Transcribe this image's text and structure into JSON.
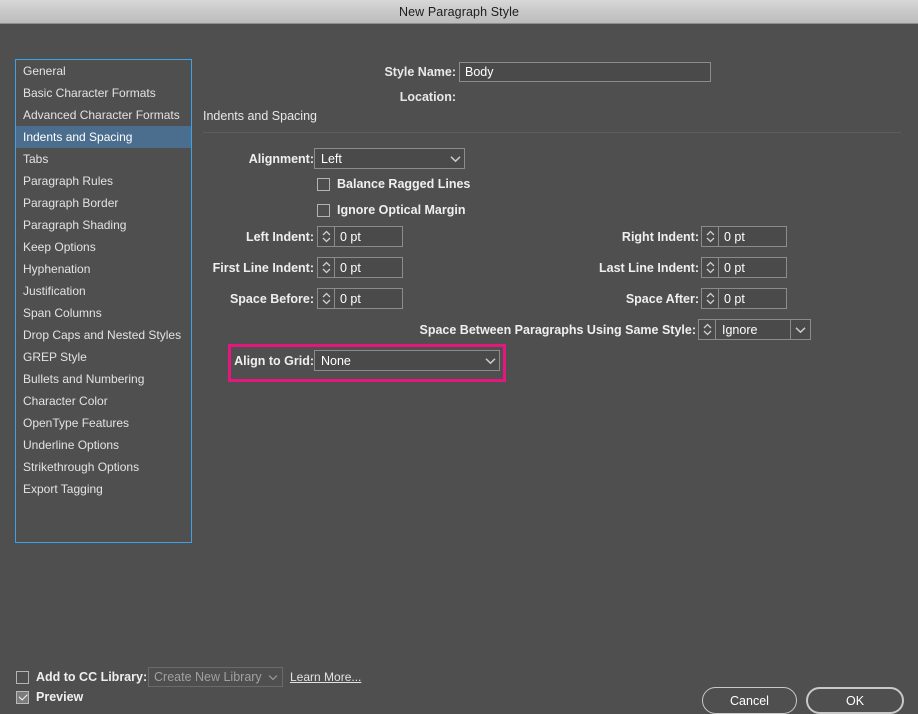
{
  "window": {
    "title": "New Paragraph Style"
  },
  "sidebar": {
    "items": [
      {
        "label": "General",
        "selected": false
      },
      {
        "label": "Basic Character Formats",
        "selected": false
      },
      {
        "label": "Advanced Character Formats",
        "selected": false
      },
      {
        "label": "Indents and Spacing",
        "selected": true
      },
      {
        "label": "Tabs",
        "selected": false
      },
      {
        "label": "Paragraph Rules",
        "selected": false
      },
      {
        "label": "Paragraph Border",
        "selected": false
      },
      {
        "label": "Paragraph Shading",
        "selected": false
      },
      {
        "label": "Keep Options",
        "selected": false
      },
      {
        "label": "Hyphenation",
        "selected": false
      },
      {
        "label": "Justification",
        "selected": false
      },
      {
        "label": "Span Columns",
        "selected": false
      },
      {
        "label": "Drop Caps and Nested Styles",
        "selected": false
      },
      {
        "label": "GREP Style",
        "selected": false
      },
      {
        "label": "Bullets and Numbering",
        "selected": false
      },
      {
        "label": "Character Color",
        "selected": false
      },
      {
        "label": "OpenType Features",
        "selected": false
      },
      {
        "label": "Underline Options",
        "selected": false
      },
      {
        "label": "Strikethrough Options",
        "selected": false
      },
      {
        "label": "Export Tagging",
        "selected": false
      }
    ]
  },
  "header": {
    "style_name_label": "Style Name:",
    "style_name_value": "Body",
    "location_label": "Location:",
    "location_value": ""
  },
  "panel": {
    "title": "Indents and Spacing",
    "alignment": {
      "label": "Alignment:",
      "value": "Left"
    },
    "balance_ragged_lines": {
      "label": "Balance Ragged Lines",
      "checked": false
    },
    "ignore_optical_margin": {
      "label": "Ignore Optical Margin",
      "checked": false
    },
    "left_indent": {
      "label": "Left Indent:",
      "value": "0 pt"
    },
    "first_line_indent": {
      "label": "First Line Indent:",
      "value": "0 pt"
    },
    "space_before": {
      "label": "Space Before:",
      "value": "0 pt"
    },
    "right_indent": {
      "label": "Right Indent:",
      "value": "0 pt"
    },
    "last_line_indent": {
      "label": "Last Line Indent:",
      "value": "0 pt"
    },
    "space_after": {
      "label": "Space After:",
      "value": "0 pt"
    },
    "space_between": {
      "label": "Space Between Paragraphs Using Same Style:",
      "value": "Ignore"
    },
    "align_to_grid": {
      "label": "Align to Grid:",
      "value": "None",
      "highlight_color": "#e5177f"
    }
  },
  "footer": {
    "add_to_cc_library": {
      "label": "Add to CC Library:",
      "checked": false
    },
    "library_select_value": "Create New Library",
    "learn_more": "Learn More...",
    "preview": {
      "label": "Preview",
      "checked": true
    },
    "cancel_label": "Cancel",
    "ok_label": "OK"
  }
}
